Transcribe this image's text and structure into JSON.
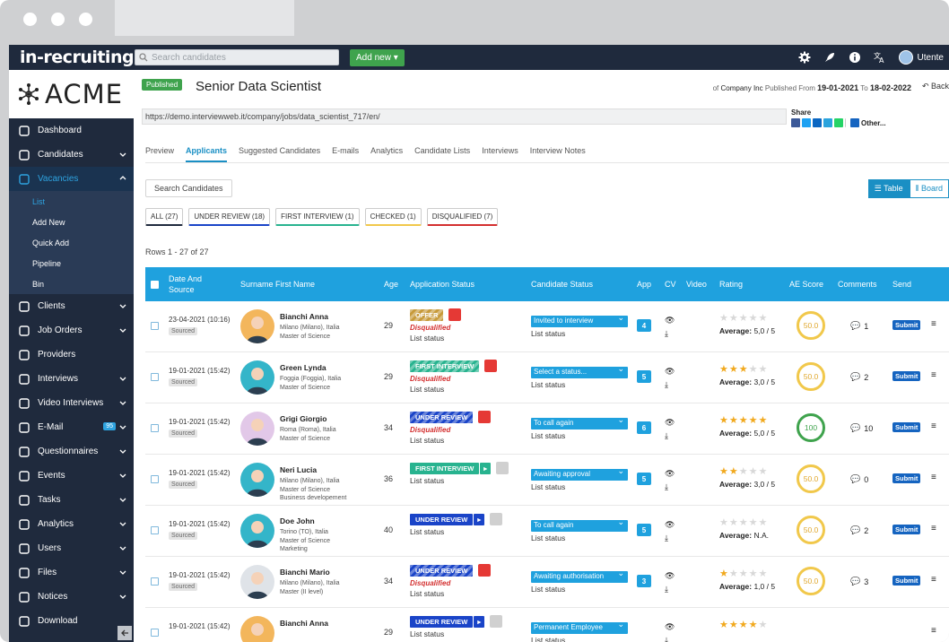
{
  "topbar": {
    "logo": "in-recruiting",
    "search_placeholder": "Search candidates",
    "add_new": "Add new ▾",
    "user": "Utente"
  },
  "brand": {
    "name": "ACME"
  },
  "sidebar": {
    "items": [
      {
        "label": "Dashboard",
        "icon": "home-icon"
      },
      {
        "label": "Candidates",
        "icon": "user-icon"
      },
      {
        "label": "Vacancies",
        "icon": "megaphone-icon"
      },
      {
        "label": "Clients",
        "icon": "user-icon"
      },
      {
        "label": "Job Orders",
        "icon": "briefcase-icon"
      },
      {
        "label": "Providers",
        "icon": "truck-icon"
      },
      {
        "label": "Interviews",
        "icon": "calendar-icon"
      },
      {
        "label": "Video Interviews",
        "icon": "chat-icon"
      },
      {
        "label": "E-Mail",
        "icon": "mail-icon",
        "badge": "95"
      },
      {
        "label": "Questionnaires",
        "icon": "checklist-icon"
      },
      {
        "label": "Events",
        "icon": "calendar-icon"
      },
      {
        "label": "Tasks",
        "icon": "check-icon"
      },
      {
        "label": "Analytics",
        "icon": "chart-icon"
      },
      {
        "label": "Users",
        "icon": "users-icon"
      },
      {
        "label": "Files",
        "icon": "file-icon"
      },
      {
        "label": "Notices",
        "icon": "book-icon"
      },
      {
        "label": "Download",
        "icon": "download-icon"
      }
    ],
    "sub_items": [
      "List",
      "Add New",
      "Quick Add",
      "Pipeline",
      "Bin"
    ]
  },
  "job": {
    "status": "Published",
    "title": "Senior Data Scientist",
    "of": "of",
    "company": "Company Inc",
    "published_from": "Published From",
    "from_date": "19-01-2021",
    "to": "To",
    "to_date": "18-02-2022",
    "back": "Back",
    "url": "https://demo.interviewweb.it/company/jobs/data_scientist_717/en/",
    "share": "Share",
    "other": "Other..."
  },
  "tabs": [
    "Preview",
    "Applicants",
    "Suggested Candidates",
    "E-mails",
    "Analytics",
    "Candidate Lists",
    "Interviews",
    "Interview Notes"
  ],
  "search_candidates": "Search Candidates",
  "views": {
    "table": "Table",
    "board": "Board"
  },
  "filters": [
    {
      "label": "ALL (27)",
      "color": "#1f2a3d"
    },
    {
      "label": "UNDER REVIEW (18)",
      "color": "#1a44c8"
    },
    {
      "label": "FIRST INTERVIEW (1)",
      "color": "#28b38f"
    },
    {
      "label": "CHECKED (1)",
      "color": "#f1c84b"
    },
    {
      "label": "DISQUALIFIED (7)",
      "color": "#d32f2f"
    }
  ],
  "rows_info": "Rows 1 - 27 of 27",
  "columns": {
    "date": "Date And Source",
    "name": "Surname First Name",
    "age": "Age",
    "app_status": "Application Status",
    "cand_status": "Candidate Status",
    "app": "App",
    "cv": "CV",
    "video": "Video",
    "rating": "Rating",
    "ae": "AE Score",
    "comments": "Comments",
    "send": "Send"
  },
  "labels": {
    "disqualified": "Disqualified",
    "list_status": "List status",
    "average": "Average:",
    "submit": "Submit"
  },
  "rows": [
    {
      "date": "23-04-2021 (10:16)",
      "source": "Sourced",
      "name": "Bianchi Anna",
      "loc": "Milano (Milano), Italia",
      "edu": "Master of Science",
      "extra": "",
      "age": "29",
      "stage": "OFFER",
      "stage_color": "#c79a3a",
      "disq": true,
      "cstatus": "Invited to interview",
      "app": "4",
      "stars": 0,
      "avg": "5,0 / 5",
      "ae": "50.0",
      "comments": "1",
      "avatar": "#f3b65c"
    },
    {
      "date": "19-01-2021 (15:42)",
      "source": "Sourced",
      "name": "Green Lynda",
      "loc": "Foggia (Foggia), Italia",
      "edu": "Master of Science",
      "extra": "",
      "age": "29",
      "stage": "FIRST INTERVIEW",
      "stage_color": "#28b38f",
      "disq": true,
      "cstatus": "Select a status...",
      "app": "5",
      "stars": 3,
      "avg": "3,0 / 5",
      "ae": "50.0",
      "comments": "2",
      "avatar": "#34b5c9"
    },
    {
      "date": "19-01-2021 (15:42)",
      "source": "Sourced",
      "name": "Grigi Giorgio",
      "loc": "Roma (Roma), Italia",
      "edu": "Master of Science",
      "extra": "",
      "age": "34",
      "stage": "UNDER REVIEW",
      "stage_color": "#1a44c8",
      "disq": true,
      "cstatus": "To call again",
      "app": "6",
      "stars": 5,
      "avg": "5,0 / 5",
      "ae": "100",
      "comments": "10",
      "avatar": "#e2c8e8"
    },
    {
      "date": "19-01-2021 (15:42)",
      "source": "Sourced",
      "name": "Neri Lucia",
      "loc": "Milano (Milano), Italia",
      "edu": "Master of Science",
      "extra": "Business developement",
      "age": "36",
      "stage": "FIRST INTERVIEW",
      "stage_color": "#28b38f",
      "disq": false,
      "cstatus": "Awaiting approval",
      "app": "5",
      "stars": 2,
      "avg": "3,0 / 5",
      "ae": "50.0",
      "comments": "0",
      "avatar": "#34b5c9"
    },
    {
      "date": "19-01-2021 (15:42)",
      "source": "Sourced",
      "name": "Doe John",
      "loc": "Torino (TO), Italia",
      "edu": "Master of Science",
      "extra": "Marketing",
      "age": "40",
      "stage": "UNDER REVIEW",
      "stage_color": "#1a44c8",
      "disq": false,
      "cstatus": "To call again",
      "app": "5",
      "stars": 0,
      "avg": "N.A.",
      "ae": "50.0",
      "comments": "2",
      "avatar": "#34b5c9"
    },
    {
      "date": "19-01-2021 (15:42)",
      "source": "Sourced",
      "name": "Bianchi Mario",
      "loc": "Milano (Milano), Italia",
      "edu": "Master (II level)",
      "extra": "",
      "age": "34",
      "stage": "UNDER REVIEW",
      "stage_color": "#1a44c8",
      "disq": true,
      "cstatus": "Awaiting authorisation",
      "app": "3",
      "stars": 1,
      "avg": "1,0 / 5",
      "ae": "50.0",
      "comments": "3",
      "avatar": "#dfe3e8"
    },
    {
      "date": "19-01-2021 (15:42)",
      "source": "",
      "name": "Bianchi Anna",
      "loc": "",
      "edu": "",
      "extra": "",
      "age": "29",
      "stage": "UNDER REVIEW",
      "stage_color": "#1a44c8",
      "disq": false,
      "cstatus": "Permanent Employee",
      "app": "",
      "stars": 4,
      "avg": "",
      "ae": "",
      "comments": "",
      "avatar": "#f3b65c"
    }
  ]
}
